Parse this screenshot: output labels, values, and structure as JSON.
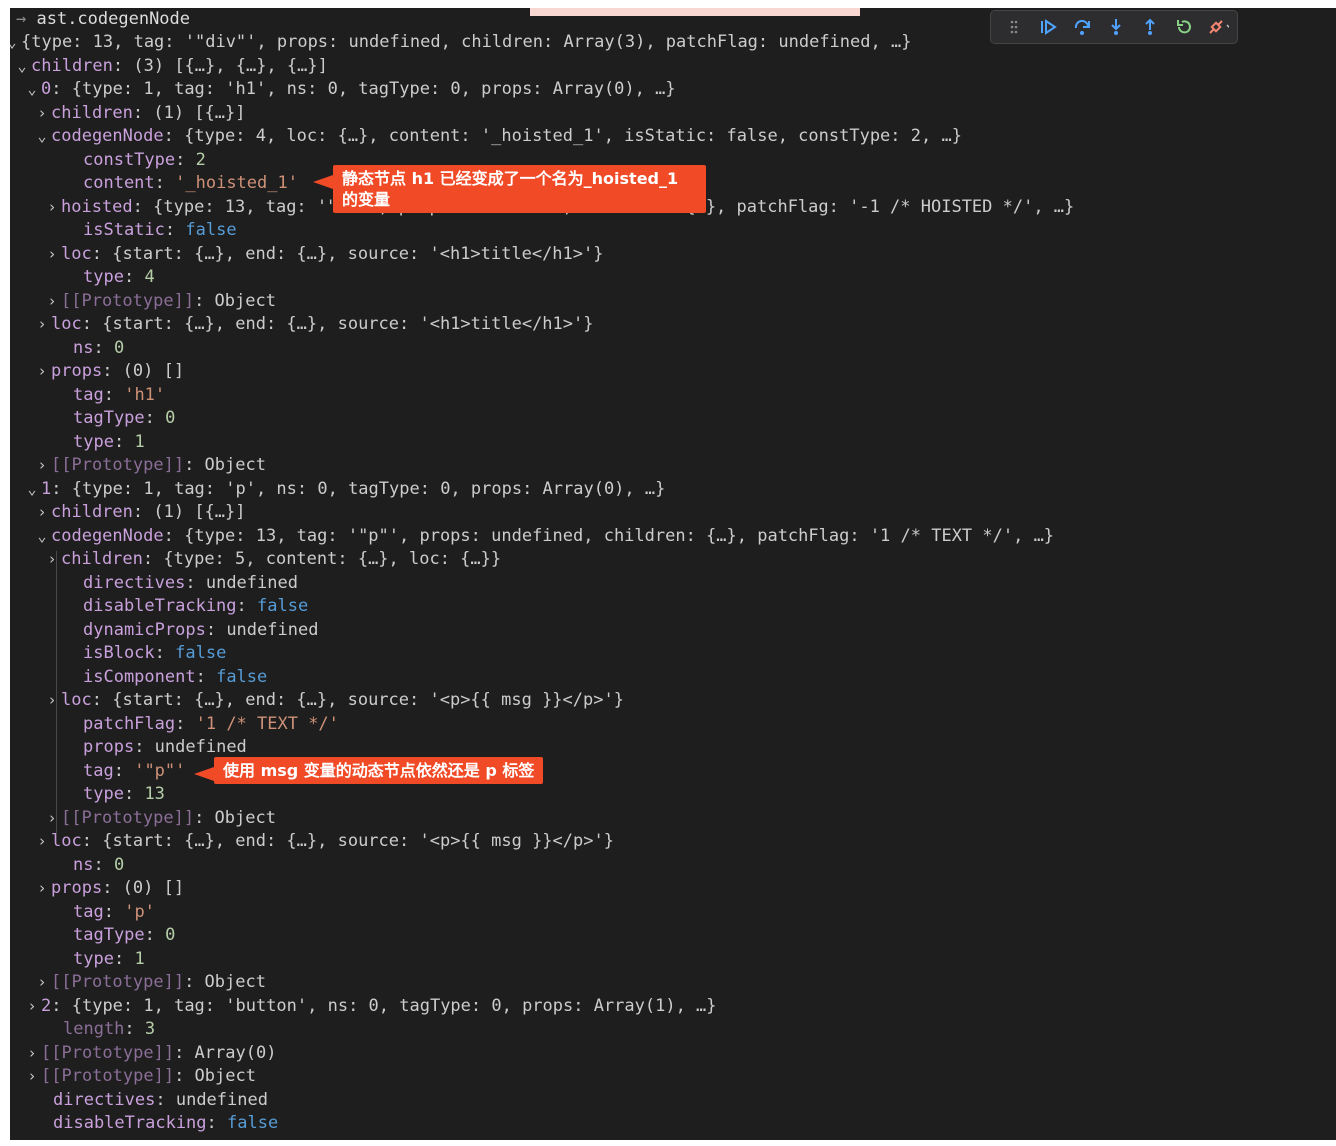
{
  "console_expression": "ast.codegenNode",
  "lines": [
    [
      [
        "a",
        "v"
      ],
      [
        "p",
        "{type: 13, tag: '\"div\"', props: undefined, children: Array(3), patchFlag: undefined, …}"
      ]
    ],
    [
      [
        "a",
        "v"
      ],
      [
        "k",
        "children"
      ],
      [
        "s",
        ": "
      ],
      [
        "p",
        "(3) [{…}, {…}, {…}]"
      ]
    ],
    [
      [
        "a",
        "v"
      ],
      [
        "k",
        "0"
      ],
      [
        "s",
        ": "
      ],
      [
        "p",
        "{type: 1, tag: 'h1', ns: 0, tagType: 0, props: Array(0), …}"
      ]
    ],
    [
      [
        "a",
        ">"
      ],
      [
        "k",
        "children"
      ],
      [
        "s",
        ": "
      ],
      [
        "p",
        "(1) [{…}]"
      ]
    ],
    [
      [
        "a",
        "v"
      ],
      [
        "k",
        "codegenNode"
      ],
      [
        "s",
        ": "
      ],
      [
        "p",
        "{type: 4, loc: {…}, content: '_hoisted_1', isStatic: false, constType: 2, …}"
      ]
    ],
    [
      [
        "k",
        "constType"
      ],
      [
        "s",
        ": "
      ],
      [
        "n",
        "2"
      ]
    ],
    [
      [
        "k",
        "content"
      ],
      [
        "s",
        ": "
      ],
      [
        "r",
        "'_hoisted_1'"
      ]
    ],
    [
      [
        "a",
        ">"
      ],
      [
        "k",
        "hoisted"
      ],
      [
        "s",
        ": "
      ],
      [
        "p",
        "{type: 13, tag: '\"h1\"', props: undefined, children: {…}, patchFlag: '-1 /* HOISTED */', …}"
      ]
    ],
    [
      [
        "k",
        "isStatic"
      ],
      [
        "s",
        ": "
      ],
      [
        "b",
        "false"
      ]
    ],
    [
      [
        "a",
        ">"
      ],
      [
        "k",
        "loc"
      ],
      [
        "s",
        ": "
      ],
      [
        "p",
        "{start: {…}, end: {…}, source: '<h1>title</h1>'}"
      ]
    ],
    [
      [
        "k",
        "type"
      ],
      [
        "s",
        ": "
      ],
      [
        "n",
        "4"
      ]
    ],
    [
      [
        "a",
        ">"
      ],
      [
        "d",
        "[[Prototype]]"
      ],
      [
        "s",
        ": "
      ],
      [
        "p",
        "Object"
      ]
    ],
    [
      [
        "a",
        ">"
      ],
      [
        "k",
        "loc"
      ],
      [
        "s",
        ": "
      ],
      [
        "p",
        "{start: {…}, end: {…}, source: '<h1>title</h1>'}"
      ]
    ],
    [
      [
        "k",
        "ns"
      ],
      [
        "s",
        ": "
      ],
      [
        "n",
        "0"
      ]
    ],
    [
      [
        "a",
        ">"
      ],
      [
        "k",
        "props"
      ],
      [
        "s",
        ": "
      ],
      [
        "p",
        "(0) []"
      ]
    ],
    [
      [
        "k",
        "tag"
      ],
      [
        "s",
        ": "
      ],
      [
        "r",
        "'h1'"
      ]
    ],
    [
      [
        "k",
        "tagType"
      ],
      [
        "s",
        ": "
      ],
      [
        "n",
        "0"
      ]
    ],
    [
      [
        "k",
        "type"
      ],
      [
        "s",
        ": "
      ],
      [
        "n",
        "1"
      ]
    ],
    [
      [
        "a",
        ">"
      ],
      [
        "d",
        "[[Prototype]]"
      ],
      [
        "s",
        ": "
      ],
      [
        "p",
        "Object"
      ]
    ],
    [
      [
        "a",
        "v"
      ],
      [
        "k",
        "1"
      ],
      [
        "s",
        ": "
      ],
      [
        "p",
        "{type: 1, tag: 'p', ns: 0, tagType: 0, props: Array(0), …}"
      ]
    ],
    [
      [
        "a",
        ">"
      ],
      [
        "k",
        "children"
      ],
      [
        "s",
        ": "
      ],
      [
        "p",
        "(1) [{…}]"
      ]
    ],
    [
      [
        "a",
        "v"
      ],
      [
        "k",
        "codegenNode"
      ],
      [
        "s",
        ": "
      ],
      [
        "p",
        "{type: 13, tag: '\"p\"', props: undefined, children: {…}, patchFlag: '1 /* TEXT */', …}"
      ]
    ],
    [
      [
        "a",
        ">"
      ],
      [
        "k",
        "children"
      ],
      [
        "s",
        ": "
      ],
      [
        "p",
        "{type: 5, content: {…}, loc: {…}}"
      ]
    ],
    [
      [
        "k",
        "directives"
      ],
      [
        "s",
        ": "
      ],
      [
        "p",
        "undefined"
      ]
    ],
    [
      [
        "k",
        "disableTracking"
      ],
      [
        "s",
        ": "
      ],
      [
        "b",
        "false"
      ]
    ],
    [
      [
        "k",
        "dynamicProps"
      ],
      [
        "s",
        ": "
      ],
      [
        "p",
        "undefined"
      ]
    ],
    [
      [
        "k",
        "isBlock"
      ],
      [
        "s",
        ": "
      ],
      [
        "b",
        "false"
      ]
    ],
    [
      [
        "k",
        "isComponent"
      ],
      [
        "s",
        ": "
      ],
      [
        "b",
        "false"
      ]
    ],
    [
      [
        "a",
        ">"
      ],
      [
        "k",
        "loc"
      ],
      [
        "s",
        ": "
      ],
      [
        "p",
        "{start: {…}, end: {…}, source: '<p>{{ msg }}</p>'}"
      ]
    ],
    [
      [
        "k",
        "patchFlag"
      ],
      [
        "s",
        ": "
      ],
      [
        "r",
        "'1 /* TEXT */'"
      ]
    ],
    [
      [
        "k",
        "props"
      ],
      [
        "s",
        ": "
      ],
      [
        "p",
        "undefined"
      ]
    ],
    [
      [
        "k",
        "tag"
      ],
      [
        "s",
        ": "
      ],
      [
        "r",
        "'\"p\"'"
      ]
    ],
    [
      [
        "k",
        "type"
      ],
      [
        "s",
        ": "
      ],
      [
        "n",
        "13"
      ]
    ],
    [
      [
        "a",
        ">"
      ],
      [
        "d",
        "[[Prototype]]"
      ],
      [
        "s",
        ": "
      ],
      [
        "p",
        "Object"
      ]
    ],
    [
      [
        "a",
        ">"
      ],
      [
        "k",
        "loc"
      ],
      [
        "s",
        ": "
      ],
      [
        "p",
        "{start: {…}, end: {…}, source: '<p>{{ msg }}</p>'}"
      ]
    ],
    [
      [
        "k",
        "ns"
      ],
      [
        "s",
        ": "
      ],
      [
        "n",
        "0"
      ]
    ],
    [
      [
        "a",
        ">"
      ],
      [
        "k",
        "props"
      ],
      [
        "s",
        ": "
      ],
      [
        "p",
        "(0) []"
      ]
    ],
    [
      [
        "k",
        "tag"
      ],
      [
        "s",
        ": "
      ],
      [
        "r",
        "'p'"
      ]
    ],
    [
      [
        "k",
        "tagType"
      ],
      [
        "s",
        ": "
      ],
      [
        "n",
        "0"
      ]
    ],
    [
      [
        "k",
        "type"
      ],
      [
        "s",
        ": "
      ],
      [
        "n",
        "1"
      ]
    ],
    [
      [
        "a",
        ">"
      ],
      [
        "d",
        "[[Prototype]]"
      ],
      [
        "s",
        ": "
      ],
      [
        "p",
        "Object"
      ]
    ],
    [
      [
        "a",
        ">"
      ],
      [
        "k",
        "2"
      ],
      [
        "s",
        ": "
      ],
      [
        "p",
        "{type: 1, tag: 'button', ns: 0, tagType: 0, props: Array(1), …}"
      ]
    ],
    [
      [
        "d",
        "length"
      ],
      [
        "s",
        ": "
      ],
      [
        "n",
        "3"
      ]
    ],
    [
      [
        "a",
        ">"
      ],
      [
        "d",
        "[[Prototype]]"
      ],
      [
        "s",
        ": "
      ],
      [
        "p",
        "Array(0)"
      ]
    ],
    [
      [
        "a",
        ">"
      ],
      [
        "d",
        "[[Prototype]]"
      ],
      [
        "s",
        ": "
      ],
      [
        "p",
        "Object"
      ]
    ],
    [
      [
        "k",
        "directives"
      ],
      [
        "s",
        ": "
      ],
      [
        "p",
        "undefined"
      ]
    ],
    [
      [
        "k",
        "disableTracking"
      ],
      [
        "s",
        ": "
      ],
      [
        "b",
        "false"
      ]
    ]
  ],
  "annotations": {
    "hoisted_note": "静态节点 h1 已经变成了一个名为_hoisted_1 的变量",
    "dynamic_note": "使用 msg 变量的动态节点依然还是 p 标签"
  },
  "toolbar": {
    "buttons": [
      "drag-handle-icon",
      "continue-icon",
      "step-over-icon",
      "step-into-icon",
      "step-out-icon",
      "restart-icon",
      "disconnect-icon"
    ],
    "colors": {
      "blue": "#4fa3ff",
      "green": "#89d185",
      "red": "#f48771"
    }
  },
  "colors": {
    "background": "#1e1e1e",
    "key": "#c9a0dc",
    "number": "#b5cea8",
    "string": "#ce9178",
    "boolean": "#569cd6",
    "callout": "#f04a27"
  }
}
